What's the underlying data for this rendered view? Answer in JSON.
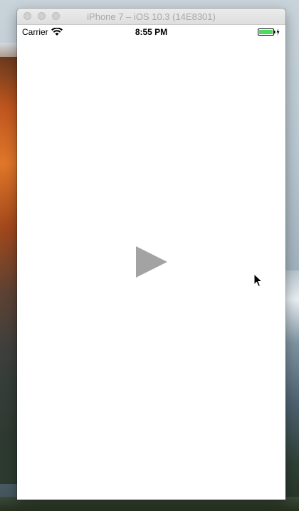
{
  "window": {
    "title": "iPhone 7 – iOS 10.3 (14E8301)"
  },
  "statusbar": {
    "carrier": "Carrier",
    "time": "8:55 PM",
    "wifi_icon": "wifi-icon",
    "battery_icon": "battery-charging-icon"
  },
  "content": {
    "play_icon": "play-icon"
  },
  "colors": {
    "play_icon": "#a3a3a3",
    "battery_fill": "#4cd964",
    "window_title_text": "#a8a8a8"
  }
}
